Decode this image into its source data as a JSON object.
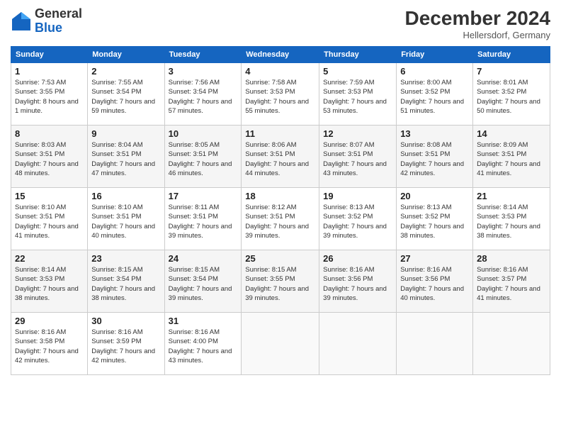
{
  "header": {
    "logo_general": "General",
    "logo_blue": "Blue",
    "title": "December 2024",
    "location": "Hellersdorf, Germany"
  },
  "columns": [
    "Sunday",
    "Monday",
    "Tuesday",
    "Wednesday",
    "Thursday",
    "Friday",
    "Saturday"
  ],
  "weeks": [
    [
      {
        "day": "1",
        "sunrise": "Sunrise: 7:53 AM",
        "sunset": "Sunset: 3:55 PM",
        "daylight": "Daylight: 8 hours and 1 minute."
      },
      {
        "day": "2",
        "sunrise": "Sunrise: 7:55 AM",
        "sunset": "Sunset: 3:54 PM",
        "daylight": "Daylight: 7 hours and 59 minutes."
      },
      {
        "day": "3",
        "sunrise": "Sunrise: 7:56 AM",
        "sunset": "Sunset: 3:54 PM",
        "daylight": "Daylight: 7 hours and 57 minutes."
      },
      {
        "day": "4",
        "sunrise": "Sunrise: 7:58 AM",
        "sunset": "Sunset: 3:53 PM",
        "daylight": "Daylight: 7 hours and 55 minutes."
      },
      {
        "day": "5",
        "sunrise": "Sunrise: 7:59 AM",
        "sunset": "Sunset: 3:53 PM",
        "daylight": "Daylight: 7 hours and 53 minutes."
      },
      {
        "day": "6",
        "sunrise": "Sunrise: 8:00 AM",
        "sunset": "Sunset: 3:52 PM",
        "daylight": "Daylight: 7 hours and 51 minutes."
      },
      {
        "day": "7",
        "sunrise": "Sunrise: 8:01 AM",
        "sunset": "Sunset: 3:52 PM",
        "daylight": "Daylight: 7 hours and 50 minutes."
      }
    ],
    [
      {
        "day": "8",
        "sunrise": "Sunrise: 8:03 AM",
        "sunset": "Sunset: 3:51 PM",
        "daylight": "Daylight: 7 hours and 48 minutes."
      },
      {
        "day": "9",
        "sunrise": "Sunrise: 8:04 AM",
        "sunset": "Sunset: 3:51 PM",
        "daylight": "Daylight: 7 hours and 47 minutes."
      },
      {
        "day": "10",
        "sunrise": "Sunrise: 8:05 AM",
        "sunset": "Sunset: 3:51 PM",
        "daylight": "Daylight: 7 hours and 46 minutes."
      },
      {
        "day": "11",
        "sunrise": "Sunrise: 8:06 AM",
        "sunset": "Sunset: 3:51 PM",
        "daylight": "Daylight: 7 hours and 44 minutes."
      },
      {
        "day": "12",
        "sunrise": "Sunrise: 8:07 AM",
        "sunset": "Sunset: 3:51 PM",
        "daylight": "Daylight: 7 hours and 43 minutes."
      },
      {
        "day": "13",
        "sunrise": "Sunrise: 8:08 AM",
        "sunset": "Sunset: 3:51 PM",
        "daylight": "Daylight: 7 hours and 42 minutes."
      },
      {
        "day": "14",
        "sunrise": "Sunrise: 8:09 AM",
        "sunset": "Sunset: 3:51 PM",
        "daylight": "Daylight: 7 hours and 41 minutes."
      }
    ],
    [
      {
        "day": "15",
        "sunrise": "Sunrise: 8:10 AM",
        "sunset": "Sunset: 3:51 PM",
        "daylight": "Daylight: 7 hours and 41 minutes."
      },
      {
        "day": "16",
        "sunrise": "Sunrise: 8:10 AM",
        "sunset": "Sunset: 3:51 PM",
        "daylight": "Daylight: 7 hours and 40 minutes."
      },
      {
        "day": "17",
        "sunrise": "Sunrise: 8:11 AM",
        "sunset": "Sunset: 3:51 PM",
        "daylight": "Daylight: 7 hours and 39 minutes."
      },
      {
        "day": "18",
        "sunrise": "Sunrise: 8:12 AM",
        "sunset": "Sunset: 3:51 PM",
        "daylight": "Daylight: 7 hours and 39 minutes."
      },
      {
        "day": "19",
        "sunrise": "Sunrise: 8:13 AM",
        "sunset": "Sunset: 3:52 PM",
        "daylight": "Daylight: 7 hours and 39 minutes."
      },
      {
        "day": "20",
        "sunrise": "Sunrise: 8:13 AM",
        "sunset": "Sunset: 3:52 PM",
        "daylight": "Daylight: 7 hours and 38 minutes."
      },
      {
        "day": "21",
        "sunrise": "Sunrise: 8:14 AM",
        "sunset": "Sunset: 3:53 PM",
        "daylight": "Daylight: 7 hours and 38 minutes."
      }
    ],
    [
      {
        "day": "22",
        "sunrise": "Sunrise: 8:14 AM",
        "sunset": "Sunset: 3:53 PM",
        "daylight": "Daylight: 7 hours and 38 minutes."
      },
      {
        "day": "23",
        "sunrise": "Sunrise: 8:15 AM",
        "sunset": "Sunset: 3:54 PM",
        "daylight": "Daylight: 7 hours and 38 minutes."
      },
      {
        "day": "24",
        "sunrise": "Sunrise: 8:15 AM",
        "sunset": "Sunset: 3:54 PM",
        "daylight": "Daylight: 7 hours and 39 minutes."
      },
      {
        "day": "25",
        "sunrise": "Sunrise: 8:15 AM",
        "sunset": "Sunset: 3:55 PM",
        "daylight": "Daylight: 7 hours and 39 minutes."
      },
      {
        "day": "26",
        "sunrise": "Sunrise: 8:16 AM",
        "sunset": "Sunset: 3:56 PM",
        "daylight": "Daylight: 7 hours and 39 minutes."
      },
      {
        "day": "27",
        "sunrise": "Sunrise: 8:16 AM",
        "sunset": "Sunset: 3:56 PM",
        "daylight": "Daylight: 7 hours and 40 minutes."
      },
      {
        "day": "28",
        "sunrise": "Sunrise: 8:16 AM",
        "sunset": "Sunset: 3:57 PM",
        "daylight": "Daylight: 7 hours and 41 minutes."
      }
    ],
    [
      {
        "day": "29",
        "sunrise": "Sunrise: 8:16 AM",
        "sunset": "Sunset: 3:58 PM",
        "daylight": "Daylight: 7 hours and 42 minutes."
      },
      {
        "day": "30",
        "sunrise": "Sunrise: 8:16 AM",
        "sunset": "Sunset: 3:59 PM",
        "daylight": "Daylight: 7 hours and 42 minutes."
      },
      {
        "day": "31",
        "sunrise": "Sunrise: 8:16 AM",
        "sunset": "Sunset: 4:00 PM",
        "daylight": "Daylight: 7 hours and 43 minutes."
      },
      null,
      null,
      null,
      null
    ]
  ]
}
